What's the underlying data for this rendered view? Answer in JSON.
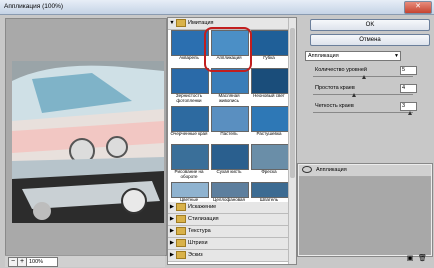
{
  "window": {
    "title": "Аппликация (100%)",
    "close_label": "✕"
  },
  "preview": {
    "zoom_value": "100%",
    "zoom_out_label": "−",
    "zoom_in_label": "+"
  },
  "gallery": {
    "open_category": "Имитация",
    "filters": [
      {
        "label": "Акварель"
      },
      {
        "label": "Аппликация"
      },
      {
        "label": "Губка"
      },
      {
        "label": "Зернистость фотопленки"
      },
      {
        "label": "Масляная живопись"
      },
      {
        "label": "Неоновый свет"
      },
      {
        "label": "Очерченные края"
      },
      {
        "label": "Пастель"
      },
      {
        "label": "Растушевка"
      },
      {
        "label": "Рисование на обороте"
      },
      {
        "label": "Сухая кисть"
      },
      {
        "label": "Фреска"
      },
      {
        "label": "Цветные карандаши"
      },
      {
        "label": "Целлофановая упаковка"
      },
      {
        "label": "Шпатель"
      }
    ],
    "selected_filter": "Аппликация",
    "categories": [
      {
        "label": "Искажение"
      },
      {
        "label": "Стилизация"
      },
      {
        "label": "Текстура"
      },
      {
        "label": "Штрихи"
      },
      {
        "label": "Эскиз"
      }
    ]
  },
  "controls": {
    "ok_label": "OK",
    "cancel_label": "Отмена",
    "filter_select": "Аппликация",
    "params": [
      {
        "label": "Количество уровней",
        "value": "5",
        "level": 0.5
      },
      {
        "label": "Простота краев",
        "value": "4",
        "level": 0.4
      },
      {
        "label": "Четкость краев",
        "value": "3",
        "level": 0.97
      }
    ]
  },
  "layers": {
    "item_label": "Аппликация"
  },
  "colors": {
    "accent_ring": "#c21e1e",
    "folder": "#d9b24a"
  }
}
